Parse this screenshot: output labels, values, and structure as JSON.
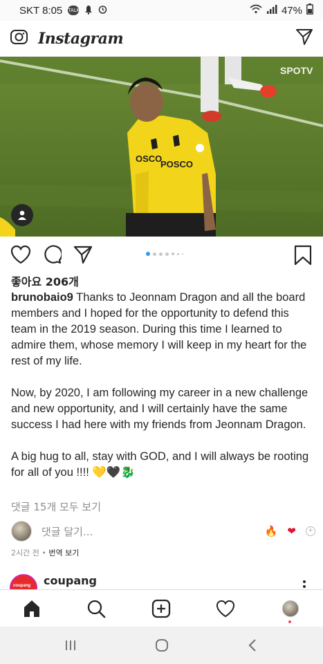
{
  "status_bar": {
    "carrier_time": "SKT 8:05",
    "talk_badge": "TALK",
    "battery": "47%"
  },
  "header": {
    "logo": "Instagram",
    "left_icon": "camera-icon",
    "right_icon": "direct-send-icon"
  },
  "post": {
    "media": {
      "watermark": "SPOTV",
      "jersey_text_1": "OSCO",
      "jersey_text_2": "POSCO"
    },
    "carousel_count": 7,
    "carousel_active_index": 0,
    "likes": "좋아요 206개",
    "caption": {
      "username": "brunobaio9",
      "paragraph_1": " Thanks to Jeonnam Dragon and all the board members and I hoped for the opportunity to defend this team in the 2019 season. During this time I learned to admire them, whose memory I will keep in my heart for the rest of my life.",
      "paragraph_2": "Now, by 2020, I am following my career in a new challenge and new opportunity, and I will certainly have the same success I had here with my friends from Jeonnam Dragon.",
      "paragraph_3": "A big hug to all, stay with GOD, and I will always be rooting for all of you !!!! 💛🖤🐉"
    },
    "view_comments": "댓글 15개 모두 보기",
    "comment_placeholder": "댓글 달기...",
    "quick_reactions": [
      "🔥",
      "❤"
    ],
    "time_ago": "2시간 전",
    "separator": " • ",
    "translate": "번역 보기"
  },
  "next_post": {
    "username": "coupang",
    "logo_text": "coupang"
  },
  "colors": {
    "accent_blue": "#3897f0",
    "notification_red": "#ed4956",
    "jersey_yellow": "#f2d51b",
    "pitch_green": "#5b7a2e"
  }
}
